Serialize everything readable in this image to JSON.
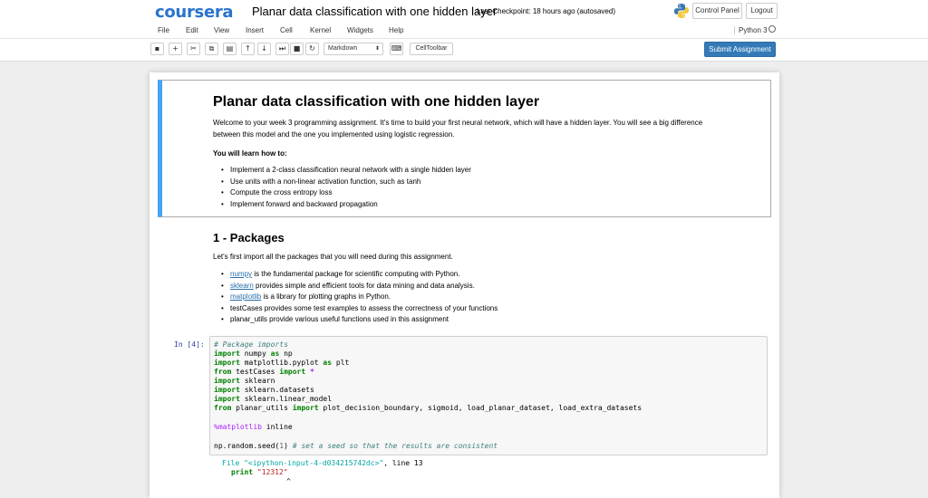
{
  "header": {
    "logo": "coursera",
    "notebook_title": "Planar data classification with one hidden layer",
    "checkpoint": "Last Checkpoint: 18 hours ago (autosaved)",
    "control_panel_label": "Control Panel",
    "logout_label": "Logout"
  },
  "menu": {
    "items": [
      "File",
      "Edit",
      "View",
      "Insert",
      "Cell",
      "Kernel",
      "Widgets",
      "Help"
    ],
    "kernel_name": "Python 3"
  },
  "toolbar": {
    "icons": [
      "save-icon",
      "plus-icon",
      "cut-icon",
      "copy-icon",
      "paste-icon",
      "arrow-up-icon",
      "arrow-down-icon",
      "step-forward-icon",
      "stop-icon",
      "restart-icon"
    ],
    "cell_type": "Markdown",
    "celltoolbar_label": "CellToolbar",
    "submit_label": "Submit Assignment"
  },
  "intro": {
    "title": "Planar data classification with one hidden layer",
    "paragraph_1": "Welcome to your week 3 programming assignment. It's time to build your first neural network, which will have a hidden layer. You will see a big difference",
    "paragraph_2": "between this model and the one you implemented using logistic regression.",
    "learn_heading": "You will learn how to:",
    "bullets": [
      "Implement a 2-class classification neural network with a single hidden layer",
      "Use units with a non-linear activation function, such as tanh",
      "Compute the cross entropy loss",
      "Implement forward and backward propagation"
    ]
  },
  "packages": {
    "title": "1 - Packages",
    "intro": "Let's first import all the packages that you will need during this assignment.",
    "items": [
      {
        "link": "numpy",
        "text": " is the fundamental package for scientific computing with Python."
      },
      {
        "link": "sklearn",
        "text": " provides simple and efficient tools for data mining and data analysis."
      },
      {
        "link": "matplotlib",
        "text": " is a library for plotting graphs in Python."
      },
      {
        "link": "",
        "text": "testCases provides some test examples to assess the correctness of your functions"
      },
      {
        "link": "",
        "text": "planar_utils provide various useful functions used in this assignment"
      }
    ]
  },
  "code_cell": {
    "prompt": "In [4]:",
    "comment_1": "# Package imports",
    "l2_mod": " numpy ",
    "l2_alias": " np",
    "l3_mod": " matplotlib.pyplot ",
    "l3_alias": " plt",
    "l4_mod": " testCases ",
    "l4_star": "*",
    "l5_mod": " sklearn",
    "l6_mod": " sklearn.datasets",
    "l7_mod": " sklearn.linear_model",
    "l8_mod": " planar_utils ",
    "l8_names": " plot_decision_boundary, sigmoid, load_planar_dataset, load_extra_datasets",
    "magic": "%matplotlib",
    "magic_arg": " inline",
    "seed_call": "np.random.seed(",
    "seed_val": "1",
    "seed_close": ") ",
    "seed_comment": "# set a seed so that the results are consistent",
    "kw_import": "import",
    "kw_from": "from",
    "kw_as": "as"
  },
  "output": {
    "file_label": "File ",
    "file_name": "\"<ipython-input-4-d034215742dc>\"",
    "line_info": ", line 13",
    "print_kw": "print ",
    "print_arg": "\"12312\"",
    "caret": "^"
  }
}
